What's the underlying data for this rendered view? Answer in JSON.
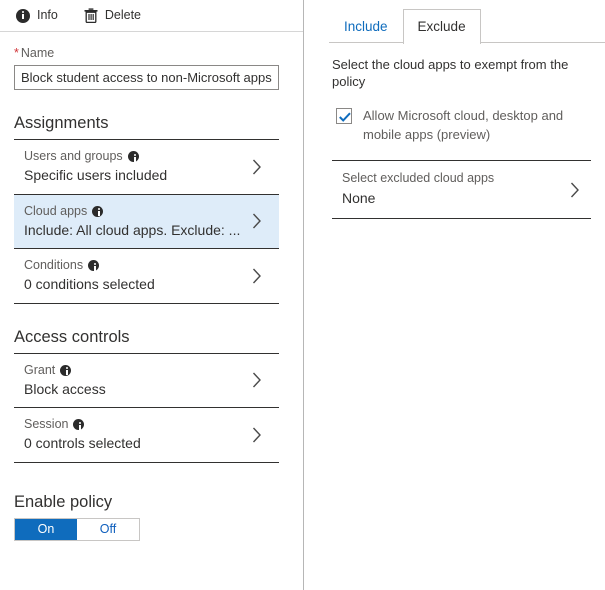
{
  "toolbar": {
    "items": [
      {
        "label": "Info",
        "icon": "info-icon"
      },
      {
        "label": "Delete",
        "icon": "trash-icon"
      }
    ]
  },
  "name_field": {
    "required_marker": "*",
    "label": "Name",
    "value": "Block student access to non-Microsoft apps",
    "placeholder": "Name"
  },
  "assignments": {
    "title": "Assignments",
    "rows": [
      {
        "label": "Users and groups",
        "value": "Specific users included",
        "info_icon": "info-icon",
        "chevron": "chevron-right-icon",
        "selected": false
      },
      {
        "label": "Cloud apps",
        "value": "Include: All cloud apps. Exclude: ...",
        "info_icon": "info-icon",
        "chevron": "chevron-right-icon",
        "selected": true
      },
      {
        "label": "Conditions",
        "value": "0 conditions selected",
        "info_icon": "info-icon",
        "chevron": "chevron-right-icon",
        "selected": false
      }
    ]
  },
  "access_controls": {
    "title": "Access controls",
    "rows": [
      {
        "label": "Grant",
        "value": "Block access",
        "info_icon": "info-icon",
        "chevron": "chevron-right-icon",
        "selected": false
      },
      {
        "label": "Session",
        "value": "0 controls selected",
        "info_icon": "info-icon",
        "chevron": "chevron-right-icon",
        "selected": false
      }
    ]
  },
  "enable_policy": {
    "label": "Enable policy",
    "on_label": "On",
    "off_label": "Off",
    "selected": "On"
  },
  "right_panel": {
    "tabs": [
      {
        "label": "Include",
        "active": false
      },
      {
        "label": "Exclude",
        "active": true
      }
    ],
    "description": "Select the cloud apps to exempt from the policy",
    "checkbox": {
      "label": "Allow Microsoft cloud, desktop and mobile apps (preview)",
      "checked": true
    },
    "row": {
      "label": "Select excluded cloud apps",
      "value": "None",
      "chevron": "chevron-right-icon"
    }
  },
  "colors": {
    "accent": "#0f6cbd",
    "selected_row_bg": "#deecf9",
    "required_star": "#d13438",
    "label_gray": "#605e5c",
    "text_dark": "#323130",
    "divider": "#c8c6c4"
  }
}
